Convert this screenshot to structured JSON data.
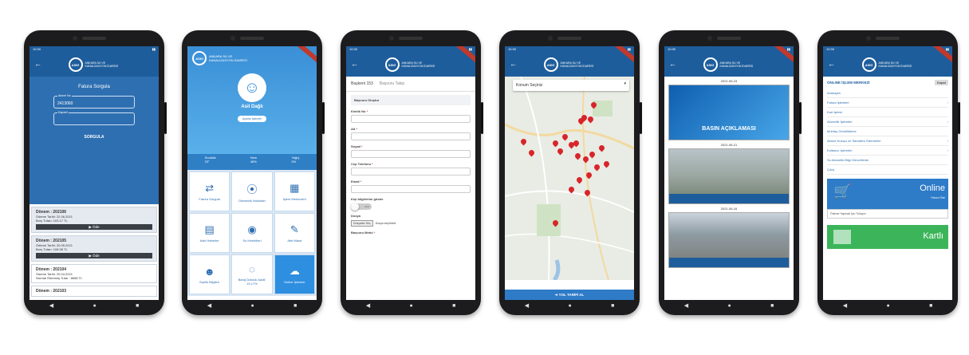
{
  "brand": {
    "logo_short": "ASKİ",
    "logo_text_small": "ANKARA SU VE KANALİZASYON İDARESİ",
    "logo_text_large": "ANKARA SU VE KANALİZASYON İDARESİ"
  },
  "screen1": {
    "title": "Fatura Sorgula",
    "field1_label": "Abone No",
    "field1_value": "2413060",
    "field2_label": "Kapasit",
    "button": "SORGULA",
    "bills": [
      {
        "period": "Dönem : 202106",
        "line1": "Ödeme Tarihi: 22.06.2021",
        "line2": "Borç Tutarı: 103.17 TL",
        "pay": "▶ Öde"
      },
      {
        "period": "Dönem : 202105",
        "line1": "Ödeme Tarihi: 20.05.2021",
        "line2": "Borç Tutarı: 108.08 TL",
        "pay": "▶ Öde"
      },
      {
        "period": "Dönem : 202104",
        "line1": "Ödeme Tarihi: 20.04.2021",
        "line2": "Normal Ödenmiş Tutar : 8658 TL"
      },
      {
        "period": "Dönem : 202103"
      }
    ]
  },
  "screen2": {
    "name": "Asil Dağlı",
    "pill": "Ayarlar İşlemler",
    "weather": [
      {
        "label": "Sıcaklık",
        "value": "23°"
      },
      {
        "label": "Nem",
        "value": "48%"
      },
      {
        "label": "Yağış",
        "value": "0%"
      }
    ],
    "tiles": [
      {
        "icon": "⇄",
        "label": "Fatura Sorgula"
      },
      {
        "icon": "⦿",
        "label": "Osmanlık Noktaları"
      },
      {
        "icon": "▦",
        "label": "İşlem Merkezleri"
      },
      {
        "icon": "▤",
        "label": "Aski Haberler"
      },
      {
        "icon": "◉",
        "label": "Su Kesintileri"
      },
      {
        "icon": "✎",
        "label": "Afet Masa"
      },
      {
        "icon": "☻",
        "label": "Eşelik Bilgileri"
      },
      {
        "icon": "◌",
        "label": "Baraj Doluluk Aadil: 19.17%"
      },
      {
        "icon": "☁",
        "label": "Online İşlemler"
      }
    ]
  },
  "screen3": {
    "tab_active": "Başkent 153",
    "tab_other": "Başvuru Takip",
    "section": "Başvuru Oluştur",
    "fields": [
      "Kimlik No",
      "Ad",
      "Soyad",
      "Cep Telefonu",
      "Email"
    ],
    "consent": "Kişi bilgilerimi göster",
    "toggle_text": "Gizli",
    "file_label": "Dosya",
    "file_button": "Dosyaları Seç",
    "file_none": "Dosya seçilmedi",
    "message_label": "Başvuru Metni"
  },
  "screen4": {
    "select": "Konum Seçiniz",
    "route": "➔ YOL TARİFİ AL"
  },
  "screen5": {
    "news": [
      {
        "date": "2021-06-23",
        "title": "BASIN AÇIKLAMASI"
      },
      {
        "date": "2021-06-21"
      },
      {
        "date": "2021-06-16"
      }
    ]
  },
  "screen6": {
    "header": "ONLINE İŞLEM MERKEZİ",
    "close": "Kapat",
    "menu": [
      "Anasayfa",
      "Fatura İşlemleri",
      "Kart İşlemi",
      "Abonelik İşlemleri",
      "Muhtaç Gönüllüleme",
      "Abone Kuluçu ve Sanalizm Ödemeleri",
      "Kullanıcı İşlemleri",
      "Su Abonelik Bilgi Güncelleme",
      "Çıkış"
    ],
    "online_big": "Online",
    "online_small": "Fatura Öde",
    "online_sub": "Ödeme Yapmak İçin Tıklayın",
    "kart_big": "Kartlı"
  },
  "colors": {
    "primary": "#1e5d9c",
    "accent": "#2e7bc8",
    "green": "#3cb55a",
    "pin": "#d8252a"
  }
}
